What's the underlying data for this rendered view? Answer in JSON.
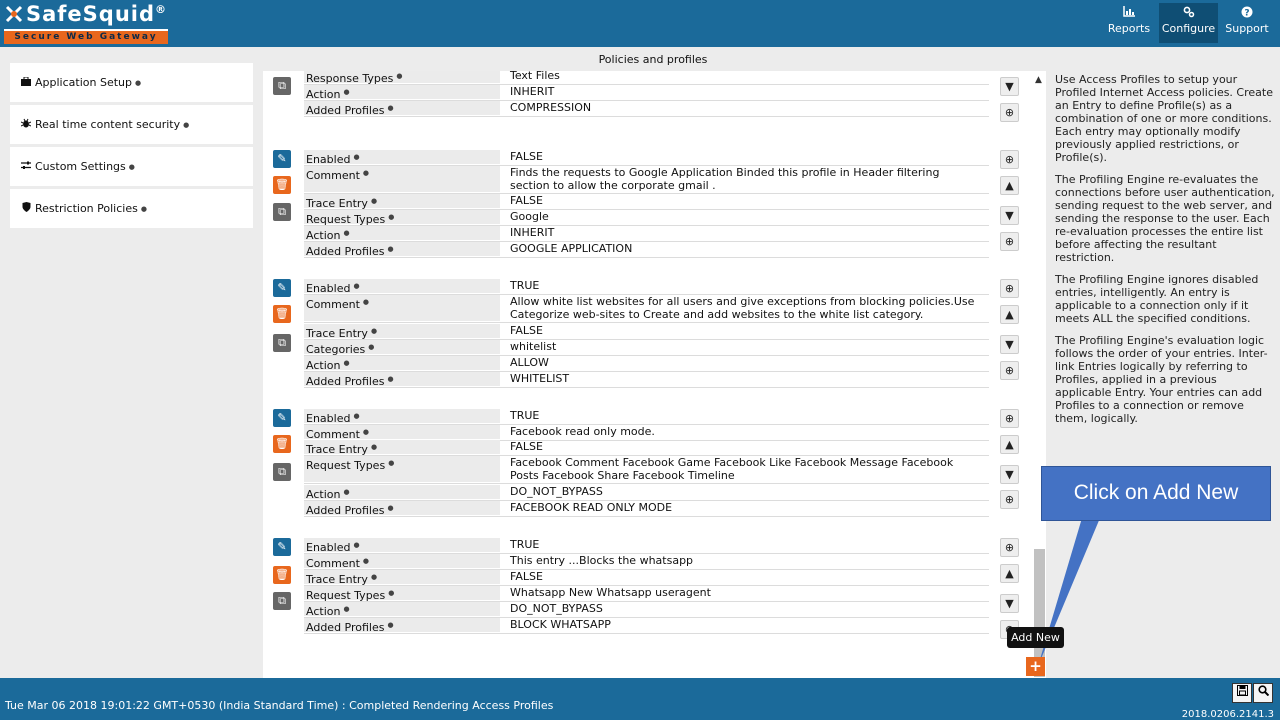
{
  "app": {
    "brand": "SafeSquid",
    "registered": "®",
    "tagline": "Secure Web Gateway"
  },
  "topnav": [
    {
      "label": "Reports",
      "icon": "chart-icon"
    },
    {
      "label": "Configure",
      "icon": "gears-icon",
      "active": true
    },
    {
      "label": "Support",
      "icon": "question-icon"
    }
  ],
  "page_title": "Policies and profiles",
  "sidebar": {
    "items": [
      {
        "label": "Application Setup",
        "icon": "briefcase-icon"
      },
      {
        "label": "Real time content security",
        "icon": "bug-icon"
      },
      {
        "label": "Custom Settings",
        "icon": "sliders-icon"
      },
      {
        "label": "Restriction Policies",
        "icon": "shield-icon"
      }
    ]
  },
  "entries": [
    {
      "fields": [
        {
          "label": "Response Types",
          "value": "Text Files"
        },
        {
          "label": "Action",
          "value": "INHERIT"
        },
        {
          "label": "Added Profiles",
          "value": "COMPRESSION"
        }
      ]
    },
    {
      "fields": [
        {
          "label": "Enabled",
          "value": "FALSE"
        },
        {
          "label": "Comment",
          "value": "Finds the requests to Google Application Binded this profile in Header filtering section to allow the corporate gmail ."
        },
        {
          "label": "Trace Entry",
          "value": "FALSE"
        },
        {
          "label": "Request Types",
          "value": "Google"
        },
        {
          "label": "Action",
          "value": "INHERIT"
        },
        {
          "label": "Added Profiles",
          "value": "GOOGLE APPLICATION"
        }
      ]
    },
    {
      "fields": [
        {
          "label": "Enabled",
          "value": "TRUE"
        },
        {
          "label": "Comment",
          "value": "Allow white list websites for all users and give exceptions from blocking policies.Use Categorize web-sites to Create and add websites to the white list category."
        },
        {
          "label": "Trace Entry",
          "value": "FALSE"
        },
        {
          "label": "Categories",
          "value": "whitelist"
        },
        {
          "label": "Action",
          "value": "ALLOW"
        },
        {
          "label": "Added Profiles",
          "value": "WHITELIST"
        }
      ]
    },
    {
      "fields": [
        {
          "label": "Enabled",
          "value": "TRUE"
        },
        {
          "label": "Comment",
          "value": "Facebook read only mode."
        },
        {
          "label": "Trace Entry",
          "value": "FALSE"
        },
        {
          "label": "Request Types",
          "value": "Facebook Comment  Facebook Game  Facebook Like  Facebook Message  Facebook Posts  Facebook Share  Facebook Timeline"
        },
        {
          "label": "Action",
          "value": "DO_NOT_BYPASS"
        },
        {
          "label": "Added Profiles",
          "value": "FACEBOOK READ ONLY MODE"
        }
      ]
    },
    {
      "fields": [
        {
          "label": "Enabled",
          "value": "TRUE"
        },
        {
          "label": "Comment",
          "value": "This entry ...Blocks the whatsapp"
        },
        {
          "label": "Trace Entry",
          "value": "FALSE"
        },
        {
          "label": "Request Types",
          "value": "Whatsapp New  Whatsapp useragent"
        },
        {
          "label": "Action",
          "value": "DO_NOT_BYPASS"
        },
        {
          "label": "Added Profiles",
          "value": "BLOCK WHATSAPP"
        }
      ]
    }
  ],
  "help": [
    "Use Access Profiles to setup your Profiled Internet Access policies. Create an Entry to define Profile(s) as a combination of one or more conditions. Each entry may optionally modify previously applied restrictions, or Profile(s).",
    "The Profiling Engine re-evaluates the connections before user authentication, sending request to the web server, and sending the response to the user. Each re-evaluation processes the entire list before affecting the resultant restriction.",
    "The Profiling Engine ignores disabled entries, intelligently. An entry is applicable to a connection only if it meets ALL the specified conditions.",
    "The Profiling Engine's evaluation logic follows the order of your entries. Inter-link Entries logically by referring to Profiles, applied in a previous applicable Entry. Your entries can add Profiles to a connection or remove them, logically."
  ],
  "callout": "Click on Add New",
  "tooltip": "Add New",
  "footer": {
    "status": "Tue Mar 06 2018 19:01:22 GMT+0530 (India Standard Time) : Completed Rendering Access Profiles",
    "version": "2018.0206.2141.3"
  },
  "colors": {
    "brand_blue": "#1b6a9a",
    "accent_orange": "#e8671d",
    "callout_blue": "#4472c4"
  }
}
